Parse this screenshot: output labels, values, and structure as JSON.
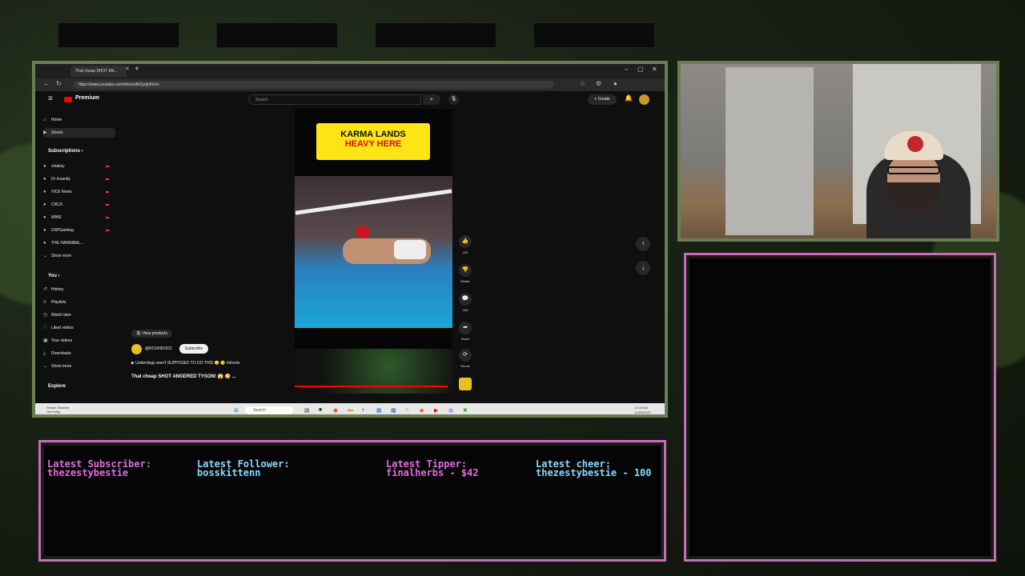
{
  "colors": {
    "accent_pink": "#e26be0",
    "accent_blue": "#8ad8ff",
    "frame_green": "#6b7d55",
    "yt_red": "#ff0000",
    "banner_yellow": "#ffe416"
  },
  "browser": {
    "tab_title": "That cheap SHOT AN...",
    "url": "https://www.youtube.com/shorts/lkOyqfyKtUw",
    "window_controls": [
      "–",
      "▢",
      "✕"
    ]
  },
  "youtube": {
    "brand": "Premium",
    "search_placeholder": "Search",
    "create_label": "Create",
    "sidebar": {
      "main": [
        {
          "icon": "home-icon",
          "glyph": "⌂",
          "label": "Home"
        },
        {
          "icon": "shorts-icon",
          "glyph": "▶",
          "label": "Shorts"
        }
      ],
      "subscriptions_header": "Subscriptions",
      "subscriptions": [
        {
          "label": "cloakzy"
        },
        {
          "label": "Dr Insanity"
        },
        {
          "label": "VICE News"
        },
        {
          "label": "CRUX"
        },
        {
          "label": "WWE"
        },
        {
          "label": "DSPGaming"
        },
        {
          "label": "THE HANNIBAL..."
        }
      ],
      "show_more": "Show more",
      "you_header": "You",
      "you_items": [
        {
          "icon": "history-icon",
          "glyph": "↺",
          "label": "History"
        },
        {
          "icon": "playlists-icon",
          "glyph": "≡",
          "label": "Playlists"
        },
        {
          "icon": "watch-later-icon",
          "glyph": "◷",
          "label": "Watch later"
        },
        {
          "icon": "liked-videos-icon",
          "glyph": "♡",
          "label": "Liked videos"
        },
        {
          "icon": "your-videos-icon",
          "glyph": "▣",
          "label": "Your videos"
        },
        {
          "icon": "downloads-icon",
          "glyph": "⤓",
          "label": "Downloads"
        }
      ],
      "show_more_2": "Show more",
      "explore_header": "Explore"
    },
    "short": {
      "banner_line1": "KARMA LANDS",
      "banner_line2": "HEAVY HERE",
      "view_products": "View products",
      "channel": "@ROUNDOD1",
      "subscribe": "Subscribe",
      "description": "Underdogs aren't SUPPOSED TO DO THIS 😳 🙂 #shorts",
      "title": "That cheap SHOT ANGERED TYSON! 😱 😳 ...",
      "progress": 0.97,
      "actions": {
        "likes": "22K",
        "dislike": "Dislike",
        "comments": "208",
        "share": "Share",
        "remix": "Remix"
      }
    }
  },
  "taskbar": {
    "weather": "Simple Weather\nHot today",
    "search": "Search",
    "time": "12:45 AM",
    "date": "12/26/2023"
  },
  "ticker": {
    "subscriber_label": "Latest Subscriber:",
    "subscriber_value": "thezestybestie",
    "follower_label": "Latest Follower:",
    "follower_value": "bosskittenn",
    "tipper_label": "Latest Tipper:",
    "tipper_value": "finalherbs - $42",
    "cheer_label": "Latest cheer:",
    "cheer_value": "thezestybestie - 100"
  }
}
